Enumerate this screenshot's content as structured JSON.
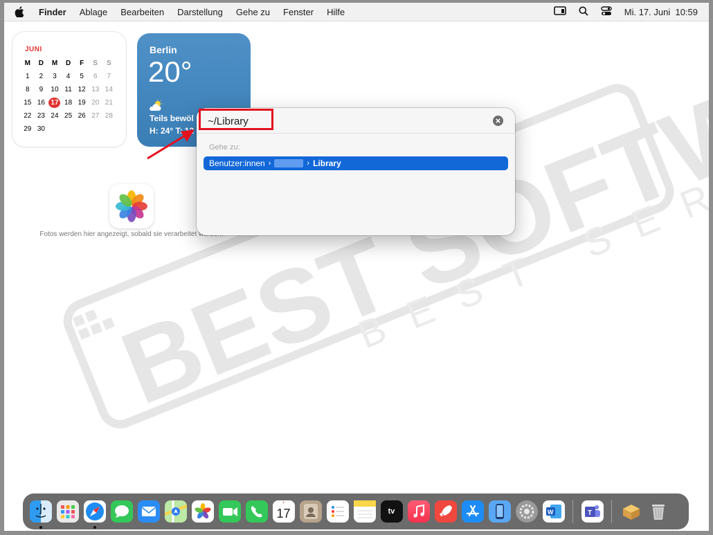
{
  "menubar": {
    "app": "Finder",
    "items": [
      "Ablage",
      "Bearbeiten",
      "Darstellung",
      "Gehe zu",
      "Fenster",
      "Hilfe"
    ],
    "datetime": "Mi. 17. Juni  10:59"
  },
  "calendar": {
    "month": "JUNI",
    "weekdays": [
      "M",
      "D",
      "M",
      "D",
      "F",
      "S",
      "S"
    ],
    "today": "17",
    "rows": [
      [
        "1",
        "2",
        "3",
        "4",
        "5",
        "6",
        "7"
      ],
      [
        "8",
        "9",
        "10",
        "11",
        "12",
        "13",
        "14"
      ],
      [
        "15",
        "16",
        "17",
        "18",
        "19",
        "20",
        "21"
      ],
      [
        "22",
        "23",
        "24",
        "25",
        "26",
        "27",
        "28"
      ],
      [
        "29",
        "30",
        "",
        "",
        "",
        "",
        ""
      ]
    ]
  },
  "weather": {
    "city": "Berlin",
    "temp": "20°",
    "condition": "Teils bewöl",
    "hilo": "H: 24° T: 12"
  },
  "photos": {
    "message": "Fotos werden hier angezeigt, sobald sie verarbeitet wurden."
  },
  "goto_dialog": {
    "path_value": "~/Library",
    "section_label": "Gehe zu:",
    "result_start": "Benutzer:innen",
    "result_end": "Library",
    "separator": "›"
  },
  "watermark": {
    "line1": "BEST SOFTWARE",
    "line2": "BEST SERVICE"
  },
  "dock": {
    "icons": [
      "finder-icon",
      "launchpad-icon",
      "safari-icon",
      "messages-icon",
      "mail-icon",
      "maps-icon",
      "photos-icon",
      "facetime-icon",
      "phone-icon",
      "calendar-icon",
      "contacts-icon",
      "reminders-icon",
      "notes-icon",
      "tv-icon",
      "music-icon",
      "rocketsim-icon",
      "app-store-icon",
      "iphone-mirroring-icon",
      "system-settings-icon",
      "word-icon",
      "teams-icon",
      "archive-icon",
      "trash-icon"
    ],
    "calendar_day": "17",
    "tv_label": "tv"
  },
  "colors": {
    "accent": "#1368d8",
    "highlight": "#e2121f",
    "today": "#e0322f"
  }
}
